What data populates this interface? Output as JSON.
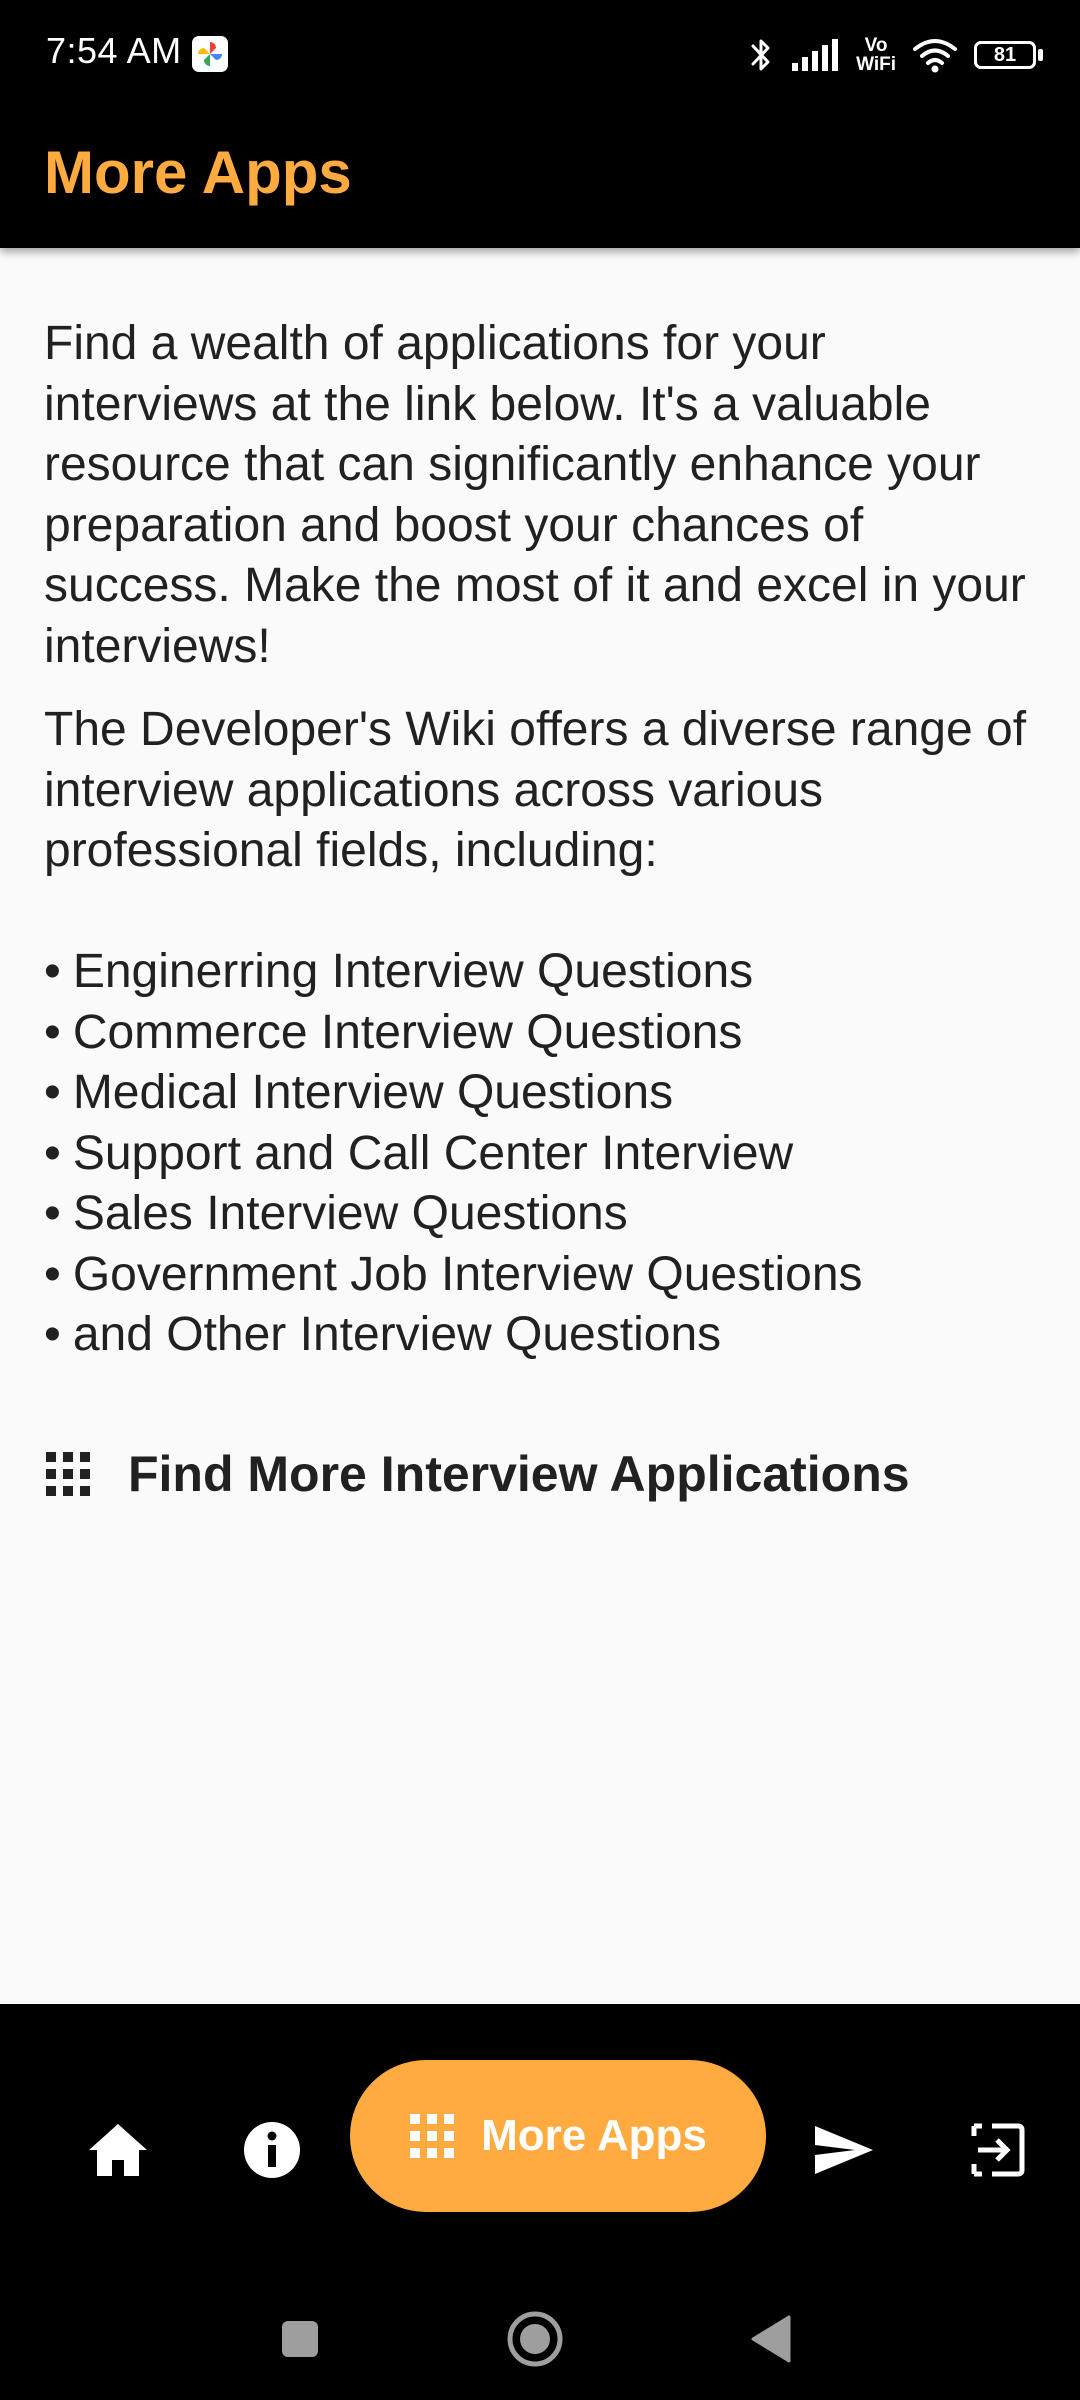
{
  "status_bar": {
    "time": "7:54 AM",
    "battery_level": 81,
    "battery_label": "81",
    "icons": [
      "photos-icon",
      "bluetooth-icon",
      "signal-icon",
      "vowifi-icon",
      "wifi-icon",
      "battery-icon"
    ],
    "vowifi_label_top": "Vo",
    "vowifi_label_bottom": "WiFi"
  },
  "app_bar": {
    "title": "More Apps",
    "title_color": "#ffab40"
  },
  "content": {
    "intro": "Find a wealth of applications for your interviews at the link below. It's a valuable resource that can significantly enhance your preparation and boost your chances of success. Make the most of it and excel in your interviews!",
    "wiki": "The Developer's Wiki offers a diverse range of interview applications across various professional fields, including:",
    "fields": [
      "Enginerring Interview Questions",
      "Commerce Interview Questions",
      "Medical Interview Questions",
      "Support and Call Center Interview",
      "Sales Interview Questions",
      "Government Job Interview Questions",
      "and Other Interview Questions"
    ],
    "find_more_label": "Find More Interview Applications",
    "find_more_icon": "apps-grid-icon"
  },
  "bottom_nav": {
    "items": [
      {
        "name": "home",
        "icon": "home-icon"
      },
      {
        "name": "info",
        "icon": "info-icon"
      },
      {
        "name": "more-apps",
        "icon": "apps-grid-icon",
        "label": "More Apps",
        "selected": true
      },
      {
        "name": "send",
        "icon": "send-icon"
      },
      {
        "name": "exit",
        "icon": "exit-icon"
      }
    ],
    "more_apps_label": "More Apps",
    "accent_color": "#ffab40"
  },
  "system_nav": {
    "buttons": [
      "recents-icon",
      "home-circle-icon",
      "back-icon"
    ]
  }
}
